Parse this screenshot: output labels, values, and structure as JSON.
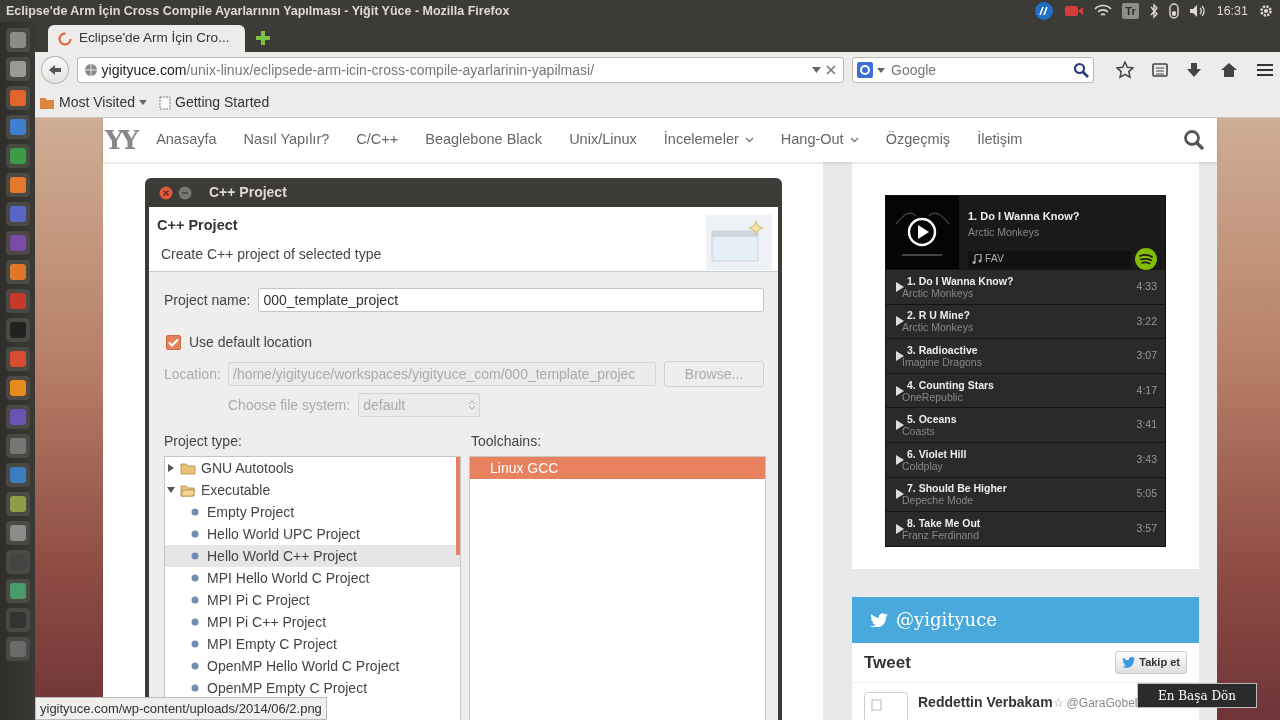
{
  "os_bar": {
    "title": "Eclipse'de Arm İçin Cross Compile Ayarlarının Yapılması - Yiğit Yüce - Mozilla Firefox",
    "keyboard_layout": "Tr",
    "clock": "16:31"
  },
  "browser": {
    "tabs": [
      {
        "label": "Eclipse'de Arm İçin Cro...",
        "selected": true
      }
    ],
    "address": {
      "domain": "yigityuce.com",
      "path": "/unix-linux/eclipsede-arm-icin-cross-compile-ayarlarinin-yapilmasi/"
    },
    "search": {
      "placeholder": "Google"
    },
    "bookmarks": [
      {
        "label": "Most Visited",
        "kind": "folder"
      },
      {
        "label": "Getting Started",
        "kind": "page"
      }
    ],
    "status_link": "yigityuce.com/wp-content/uploads/2014/06/2.png"
  },
  "site_nav": {
    "logo": "YY",
    "items": [
      {
        "label": "Anasayfa",
        "has_menu": false
      },
      {
        "label": "Nasıl Yapılır?",
        "has_menu": false
      },
      {
        "label": "C/C++",
        "has_menu": false
      },
      {
        "label": "Beaglebone Black",
        "has_menu": false
      },
      {
        "label": "Unix/Linux",
        "has_menu": false
      },
      {
        "label": "İncelemeler",
        "has_menu": true
      },
      {
        "label": "Hang-Out",
        "has_menu": true
      },
      {
        "label": "Özgeçmiş",
        "has_menu": false
      },
      {
        "label": "İletişim",
        "has_menu": false
      }
    ]
  },
  "dialog": {
    "title": "C++ Project",
    "heading": "C++ Project",
    "description": "Create C++ project of selected type",
    "project_name_label": "Project name:",
    "project_name": "000_template_project",
    "use_default_location": {
      "label": "Use default location",
      "checked": true
    },
    "location_label": "Location:",
    "location": "/home/yigityuce/workspaces/yigityuce_com/000_template_projec",
    "browse_button": "Browse...",
    "file_system_label": "Choose file system:",
    "file_system": "default",
    "project_type_label": "Project type:",
    "toolchains_label": "Toolchains:",
    "project_types": [
      {
        "label": "GNU Autotools",
        "expanded": false,
        "selected": false
      },
      {
        "label": "Executable",
        "expanded": true,
        "selected": false,
        "children": [
          {
            "label": "Empty Project",
            "selected": false
          },
          {
            "label": "Hello World UPC Project",
            "selected": false
          },
          {
            "label": "Hello World C++ Project",
            "selected": true
          },
          {
            "label": "MPI Hello World C Project",
            "selected": false
          },
          {
            "label": "MPI Pi C Project",
            "selected": false
          },
          {
            "label": "MPI Pi C++ Project",
            "selected": false
          },
          {
            "label": "MPI Empty C Project",
            "selected": false
          },
          {
            "label": "OpenMP Hello World C Project",
            "selected": false
          },
          {
            "label": "OpenMP Empty C Project",
            "selected": false
          }
        ]
      }
    ],
    "toolchains": [
      {
        "label": "Linux GCC",
        "selected": true
      }
    ]
  },
  "spotify": {
    "now_playing": {
      "title": "1. Do I Wanna Know?",
      "artist": "Arctic Monkeys",
      "playlist": "FAV"
    },
    "tracks": [
      {
        "title": "1. Do I Wanna Know?",
        "artist": "Arctic Monkeys",
        "duration": "4:33"
      },
      {
        "title": "2. R U Mine?",
        "artist": "Arctic Monkeys",
        "duration": "3:22"
      },
      {
        "title": "3. Radioactive",
        "artist": "Imagine Dragons",
        "duration": "3:07"
      },
      {
        "title": "4. Counting Stars",
        "artist": "OneRepublic",
        "duration": "4:17"
      },
      {
        "title": "5. Oceans",
        "artist": "Coasts",
        "duration": "3:41"
      },
      {
        "title": "6. Violet Hill",
        "artist": "Coldplay",
        "duration": "3:43"
      },
      {
        "title": "7. Should Be Higher",
        "artist": "Depeche Mode",
        "duration": "5:05"
      },
      {
        "title": "8. Take Me Out",
        "artist": "Franz Ferdinand",
        "duration": "3:57"
      }
    ]
  },
  "twitter": {
    "handle": "@yigityuce",
    "heading": "Tweet",
    "follow_button": "Takip et",
    "tweets": [
      {
        "name": "Reddettin Verbakam",
        "mark": "☆",
        "username": "@GaraGobel"
      }
    ]
  },
  "back_to_top": "En Başa Dön"
}
